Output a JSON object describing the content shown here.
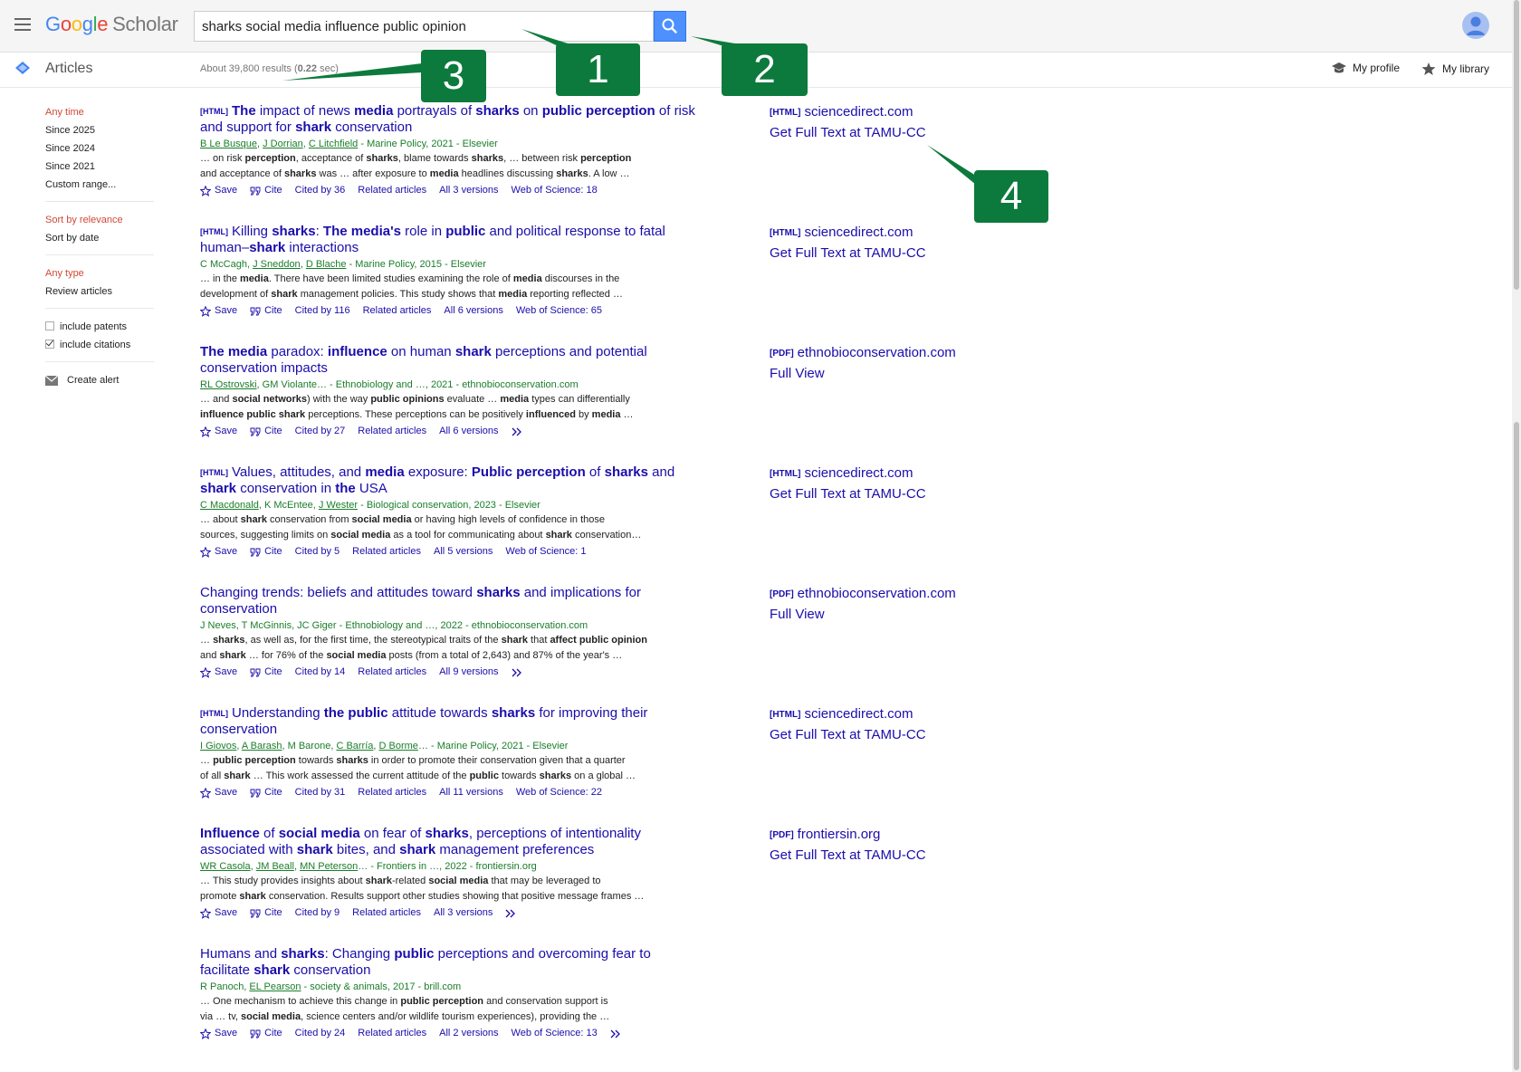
{
  "header": {
    "logo_google": [
      "G",
      "o",
      "o",
      "g",
      "l",
      "e"
    ],
    "logo_scholar": "Scholar",
    "search_value": "sharks social media influence public opinion"
  },
  "subbar": {
    "articles_label": "Articles",
    "results_count": "About 39,800 results (",
    "results_time": "0.22",
    "results_time_suffix": " sec)",
    "my_profile": "My profile",
    "my_library": "My library"
  },
  "left_nav": {
    "time": [
      "Any time",
      "Since 2025",
      "Since 2024",
      "Since 2021",
      "Custom range..."
    ],
    "sort": [
      "Sort by relevance",
      "Sort by date"
    ],
    "type": [
      "Any type",
      "Review articles"
    ],
    "include_patents": "include patents",
    "include_citations": "include citations",
    "create_alert": "Create alert"
  },
  "results": [
    {
      "tag": "[HTML]",
      "title_html": "<b>The</b> impact of news <b>media</b> portrayals of <b>sharks</b> on <b>public perception</b> of risk and support for <b>shark</b> conservation",
      "authors_html": "<u>B Le Busque</u>, <u>J Dorrian</u>, <u>C Litchfield</u> - Marine Policy, 2021 - Elsevier",
      "snippet_html": "… on risk <b>perception</b>, acceptance of <b>sharks</b>, blame towards <b>sharks</b>, … between risk <b>perception</b><br>and acceptance of <b>sharks</b> was … after exposure to <b>media</b> headlines discussing <b>sharks</b>. A low …",
      "cited": "Cited by 36",
      "versions": "All 3 versions",
      "wos": "Web of Science: 18",
      "side_tag": "[HTML]",
      "side_domain": "sciencedirect.com",
      "side_link": "Get Full Text at TAMU-CC"
    },
    {
      "tag": "[HTML]",
      "title_html": "Killing <b>sharks</b>: <b>The media's</b> role in <b>public</b> and political response to fatal human–<b>shark</b> interactions",
      "authors_html": "C McCagh, <u>J Sneddon</u>, <u>D Blache</u> - Marine Policy, 2015 - Elsevier",
      "snippet_html": "… in the <b>media</b>. There have been limited studies examining the role of <b>media</b> discourses in the<br>development of <b>shark</b> management policies. This study shows that <b>media</b> reporting reflected …",
      "cited": "Cited by 116",
      "versions": "All 6 versions",
      "wos": "Web of Science: 65",
      "side_tag": "[HTML]",
      "side_domain": "sciencedirect.com",
      "side_link": "Get Full Text at TAMU-CC"
    },
    {
      "tag": "",
      "title_html": "<b>The media</b> paradox: <b>influence</b> on human <b>shark</b> perceptions and potential conservation impacts",
      "authors_html": "<u>RL Ostrovski</u>, GM Violante… - Ethnobiology and …, 2021 - ethnobioconservation.com",
      "snippet_html": "… and <b>social networks</b>) with the way <b>public opinions</b> evaluate … <b>media</b> types can differentially<br><b>influence public shark</b> perceptions. These perceptions can be positively <b>influenced</b> by <b>media</b> …",
      "cited": "Cited by 27",
      "versions": "All 6 versions",
      "wos": "",
      "side_tag": "[PDF]",
      "side_domain": "ethnobioconservation.com",
      "side_link": "Full View"
    },
    {
      "tag": "[HTML]",
      "title_html": "Values, attitudes, and <b>media</b> exposure: <b>Public perception</b> of <b>sharks</b> and <b>shark</b> conservation in <b>the</b> USA",
      "authors_html": "<u>C Macdonald</u>, K McEntee, <u>J Wester</u> - Biological conservation, 2023 - Elsevier",
      "snippet_html": "… about <b>shark</b> conservation from <b>social media</b> or having high levels of confidence in those<br>sources, suggesting limits on <b>social media</b> as a tool for communicating about <b>shark</b> conservation…",
      "cited": "Cited by 5",
      "versions": "All 5 versions",
      "wos": "Web of Science: 1",
      "side_tag": "[HTML]",
      "side_domain": "sciencedirect.com",
      "side_link": "Get Full Text at TAMU-CC"
    },
    {
      "tag": "",
      "title_html": "Changing trends: beliefs and attitudes toward <b>sharks</b> and implications for conservation",
      "authors_html": "J Neves, T McGinnis, JC Giger - Ethnobiology and …, 2022 - ethnobioconservation.com",
      "snippet_html": "… <b>sharks</b>, as well as, for the first time, the stereotypical traits of the <b>shark</b> that <b>affect public opinion</b><br>and <b>shark</b> … for 76% of the <b>social media</b> posts (from a total of 2,643) and 87% of the year's …",
      "cited": "Cited by 14",
      "versions": "All 9 versions",
      "wos": "",
      "side_tag": "[PDF]",
      "side_domain": "ethnobioconservation.com",
      "side_link": "Full View"
    },
    {
      "tag": "[HTML]",
      "title_html": "Understanding <b>the public</b> attitude towards <b>sharks</b> for improving their conservation",
      "authors_html": "<u>I Giovos</u>, <u>A Barash</u>, M Barone, <u>C Barría</u>, <u>D Borme</u>… - Marine Policy, 2021 - Elsevier",
      "snippet_html": "… <b>public perception</b> towards <b>sharks</b> in order to promote their conservation given that a quarter<br>of all <b>shark</b> … This work assessed the current attitude of the <b>public</b> towards <b>sharks</b> on a global …",
      "cited": "Cited by 31",
      "versions": "All 11 versions",
      "wos": "Web of Science: 22",
      "side_tag": "[HTML]",
      "side_domain": "sciencedirect.com",
      "side_link": "Get Full Text at TAMU-CC"
    },
    {
      "tag": "",
      "title_html": "<b>Influence</b> of <b>social media</b> on fear of <b>sharks</b>, perceptions of intentionality associated with <b>shark</b> bites, and <b>shark</b> management preferences",
      "authors_html": "<u>WR Casola</u>, <u>JM Beall</u>, <u>MN Peterson</u>… - Frontiers in …, 2022 - frontiersin.org",
      "snippet_html": "… This study provides insights about <b>shark</b>-related <b>social media</b> that may be leveraged to<br>promote <b>shark</b> conservation. Results support other studies showing that positive message frames …",
      "cited": "Cited by 9",
      "versions": "All 3 versions",
      "wos": "",
      "side_tag": "[PDF]",
      "side_domain": "frontiersin.org",
      "side_link": "Get Full Text at TAMU-CC"
    },
    {
      "tag": "",
      "title_html": "Humans and <b>sharks</b>: Changing <b>public</b> perceptions and overcoming fear to facilitate <b>shark</b> conservation",
      "authors_html": "R Panoch, <u>EL Pearson</u> - society &amp; animals, 2017 - brill.com",
      "snippet_html": "… One mechanism to achieve this change in <b>public perception</b> and conservation support is<br>via … tv, <b>social media</b>, science centers and/or wildlife tourism experiences), providing the …",
      "cited": "Cited by 24",
      "versions": "All 2 versions",
      "wos": "Web of Science: 13",
      "side_tag": "",
      "side_domain": "",
      "side_link": ""
    }
  ],
  "actions": {
    "save": "Save",
    "cite": "Cite",
    "related": "Related articles"
  },
  "callouts": [
    "1",
    "2",
    "3",
    "4"
  ],
  "colors": {
    "callout": "#0c7a3c",
    "search_button": "#4d90fe",
    "link": "#1a0dab",
    "author_green": "#1a7e2a",
    "selected_red": "#d14836"
  }
}
